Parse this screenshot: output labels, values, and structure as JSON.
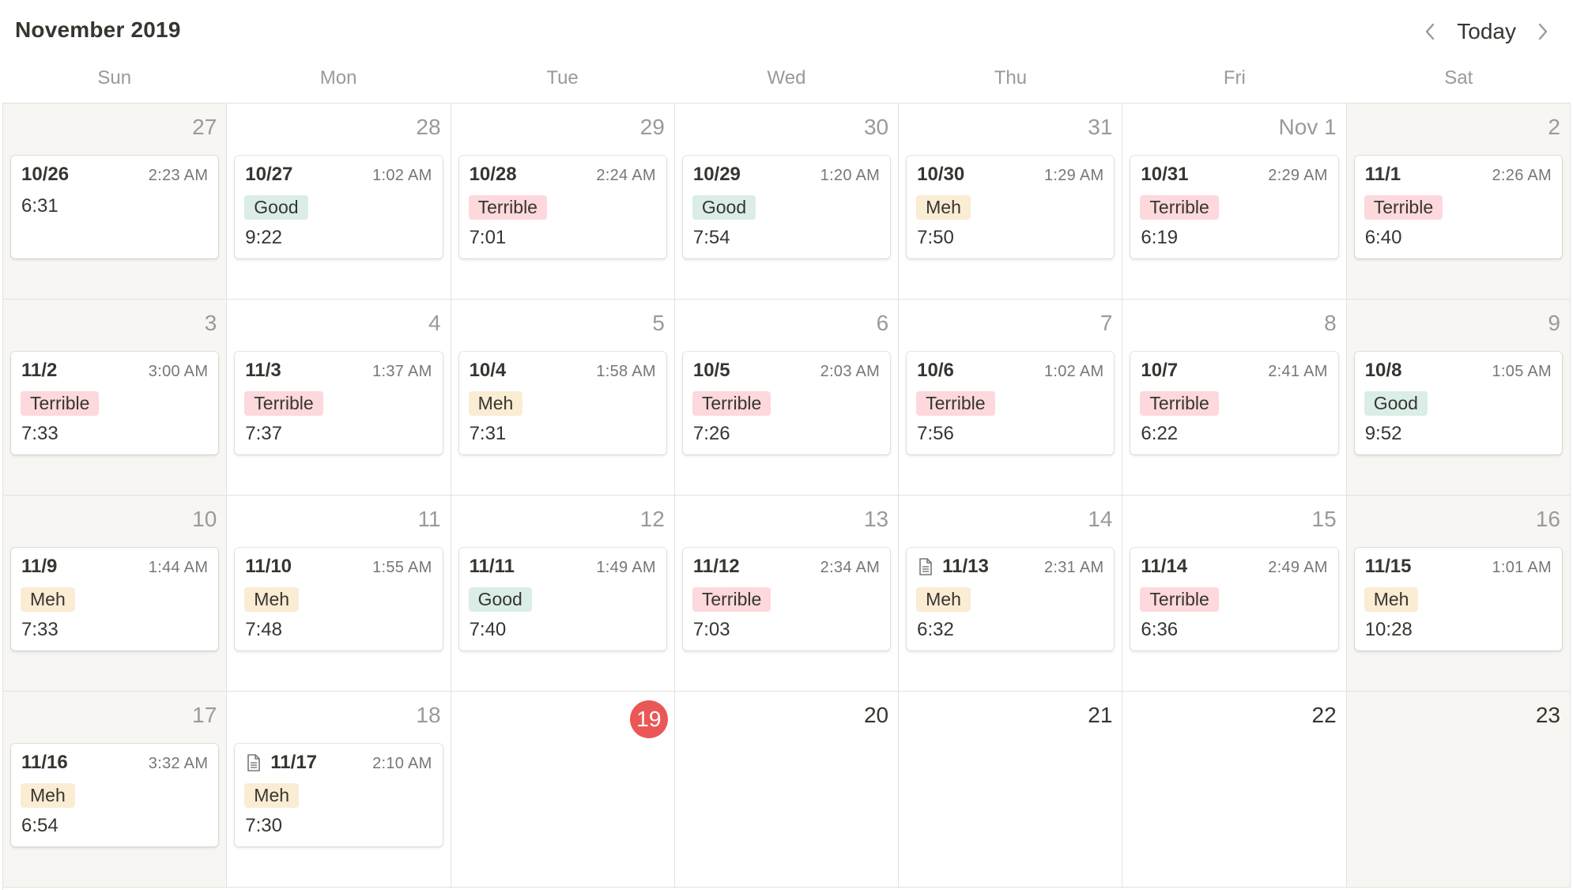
{
  "header": {
    "title": "November 2019",
    "today_label": "Today"
  },
  "weekdays": [
    "Sun",
    "Mon",
    "Tue",
    "Wed",
    "Thu",
    "Fri",
    "Sat"
  ],
  "colors": {
    "today": "#eb5757",
    "good": "#dbede7",
    "meh": "#fbecd4",
    "terrible": "#fdd8dc",
    "weekend": "#f7f6f3"
  },
  "weeks": [
    [
      {
        "day": "27",
        "other_month": true,
        "entry": {
          "title": "10/26",
          "time": "2:23 AM",
          "rating": "",
          "sleep": "6:31",
          "doc": false
        }
      },
      {
        "day": "28",
        "other_month": true,
        "entry": {
          "title": "10/27",
          "time": "1:02 AM",
          "rating": "Good",
          "sleep": "9:22",
          "doc": false
        }
      },
      {
        "day": "29",
        "other_month": true,
        "entry": {
          "title": "10/28",
          "time": "2:24 AM",
          "rating": "Terrible",
          "sleep": "7:01",
          "doc": false
        }
      },
      {
        "day": "30",
        "other_month": true,
        "entry": {
          "title": "10/29",
          "time": "1:20 AM",
          "rating": "Good",
          "sleep": "7:54",
          "doc": false
        }
      },
      {
        "day": "31",
        "other_month": true,
        "entry": {
          "title": "10/30",
          "time": "1:29 AM",
          "rating": "Meh",
          "sleep": "7:50",
          "doc": false
        }
      },
      {
        "day": "Nov 1",
        "other_month": true,
        "entry": {
          "title": "10/31",
          "time": "2:29 AM",
          "rating": "Terrible",
          "sleep": "6:19",
          "doc": false
        }
      },
      {
        "day": "2",
        "other_month": true,
        "entry": {
          "title": "11/1",
          "time": "2:26 AM",
          "rating": "Terrible",
          "sleep": "6:40",
          "doc": false
        }
      }
    ],
    [
      {
        "day": "3",
        "other_month": true,
        "entry": {
          "title": "11/2",
          "time": "3:00 AM",
          "rating": "Terrible",
          "sleep": "7:33",
          "doc": false
        }
      },
      {
        "day": "4",
        "other_month": true,
        "entry": {
          "title": "11/3",
          "time": "1:37 AM",
          "rating": "Terrible",
          "sleep": "7:37",
          "doc": false
        }
      },
      {
        "day": "5",
        "other_month": true,
        "entry": {
          "title": "10/4",
          "time": "1:58 AM",
          "rating": "Meh",
          "sleep": "7:31",
          "doc": false
        }
      },
      {
        "day": "6",
        "other_month": true,
        "entry": {
          "title": "10/5",
          "time": "2:03 AM",
          "rating": "Terrible",
          "sleep": "7:26",
          "doc": false
        }
      },
      {
        "day": "7",
        "other_month": true,
        "entry": {
          "title": "10/6",
          "time": "1:02 AM",
          "rating": "Terrible",
          "sleep": "7:56",
          "doc": false
        }
      },
      {
        "day": "8",
        "other_month": true,
        "entry": {
          "title": "10/7",
          "time": "2:41 AM",
          "rating": "Terrible",
          "sleep": "6:22",
          "doc": false
        }
      },
      {
        "day": "9",
        "other_month": true,
        "entry": {
          "title": "10/8",
          "time": "1:05 AM",
          "rating": "Good",
          "sleep": "9:52",
          "doc": false
        }
      }
    ],
    [
      {
        "day": "10",
        "other_month": true,
        "entry": {
          "title": "11/9",
          "time": "1:44 AM",
          "rating": "Meh",
          "sleep": "7:33",
          "doc": false
        }
      },
      {
        "day": "11",
        "other_month": true,
        "entry": {
          "title": "11/10",
          "time": "1:55 AM",
          "rating": "Meh",
          "sleep": "7:48",
          "doc": false
        }
      },
      {
        "day": "12",
        "other_month": true,
        "entry": {
          "title": "11/11",
          "time": "1:49 AM",
          "rating": "Good",
          "sleep": "7:40",
          "doc": false
        }
      },
      {
        "day": "13",
        "other_month": true,
        "entry": {
          "title": "11/12",
          "time": "2:34 AM",
          "rating": "Terrible",
          "sleep": "7:03",
          "doc": false
        }
      },
      {
        "day": "14",
        "other_month": true,
        "entry": {
          "title": "11/13",
          "time": "2:31 AM",
          "rating": "Meh",
          "sleep": "6:32",
          "doc": true
        }
      },
      {
        "day": "15",
        "other_month": true,
        "entry": {
          "title": "11/14",
          "time": "2:49 AM",
          "rating": "Terrible",
          "sleep": "6:36",
          "doc": false
        }
      },
      {
        "day": "16",
        "other_month": true,
        "entry": {
          "title": "11/15",
          "time": "1:01 AM",
          "rating": "Meh",
          "sleep": "10:28",
          "doc": false
        }
      }
    ],
    [
      {
        "day": "17",
        "other_month": true,
        "entry": {
          "title": "11/16",
          "time": "3:32 AM",
          "rating": "Meh",
          "sleep": "6:54",
          "doc": false
        }
      },
      {
        "day": "18",
        "other_month": true,
        "entry": {
          "title": "11/17",
          "time": "2:10 AM",
          "rating": "Meh",
          "sleep": "7:30",
          "doc": true
        }
      },
      {
        "day": "19",
        "today": true,
        "entry": null
      },
      {
        "day": "20",
        "other_month": false,
        "entry": null
      },
      {
        "day": "21",
        "other_month": false,
        "entry": null
      },
      {
        "day": "22",
        "other_month": false,
        "entry": null
      },
      {
        "day": "23",
        "other_month": false,
        "entry": null
      }
    ]
  ]
}
